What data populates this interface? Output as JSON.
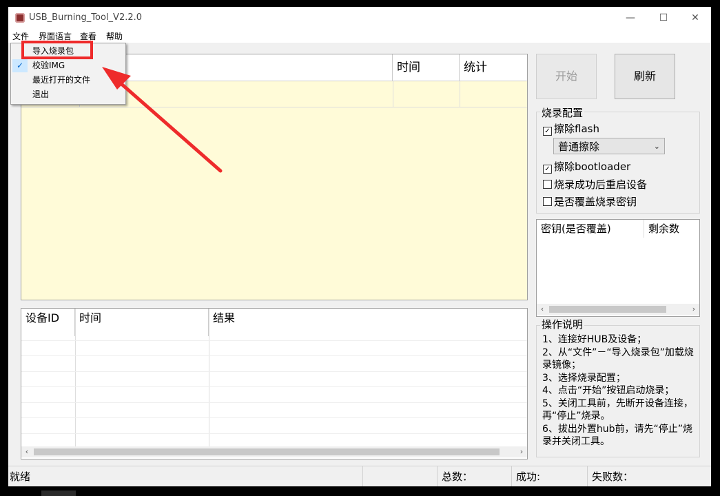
{
  "window": {
    "title": "USB_Burning_Tool_V2.2.0",
    "minimize": "—",
    "maximize": "☐",
    "close": "✕"
  },
  "menubar": {
    "items": [
      "文件",
      "界面语言",
      "查看",
      "帮助"
    ]
  },
  "file_menu": {
    "items": [
      {
        "label": "导入烧录包",
        "checked": false,
        "highlighted": true
      },
      {
        "label": "校验IMG",
        "checked": true
      },
      {
        "label": "最近打开的文件",
        "checked": false
      },
      {
        "label": "退出",
        "checked": false
      }
    ],
    "check_glyph": "✓"
  },
  "upper_list": {
    "columns": [
      "",
      "",
      "时间",
      "统计"
    ]
  },
  "lower_list": {
    "columns": [
      "设备ID",
      "时间",
      "结果"
    ]
  },
  "buttons": {
    "start": "开始",
    "refresh": "刷新"
  },
  "burn_config": {
    "title": "烧录配置",
    "erase_flash": {
      "label": "擦除flash",
      "checked": true
    },
    "erase_mode": "普通擦除",
    "erase_bootloader": {
      "label": "擦除bootloader",
      "checked": true
    },
    "reboot_after": {
      "label": "烧录成功后重启设备",
      "checked": false
    },
    "overwrite_key": {
      "label": "是否覆盖烧录密钥",
      "checked": false
    }
  },
  "key_list": {
    "columns": [
      "密钥(是否覆盖)",
      "剩余数"
    ]
  },
  "instructions": {
    "title": "操作说明",
    "text": "1、连接好HUB及设备；\n2、从“文件”－“导入烧录包”加载烧录镜像；\n3、选择烧录配置；\n4、点击“开始”按钮启动烧录；\n5、关闭工具前，先断开设备连接，再“停止”烧录。\n6、拔出外置hub前，请先“停止”烧录并关闭工具。"
  },
  "statusbar": {
    "status": "就绪",
    "total": "总数：",
    "success": "成功:",
    "fail": "失败数："
  },
  "scroll": {
    "left": "‹",
    "right": "›",
    "checkmark": "✓"
  },
  "colors": {
    "list_bg": "#fffbd8",
    "annotation_red": "#ee2b2b"
  }
}
